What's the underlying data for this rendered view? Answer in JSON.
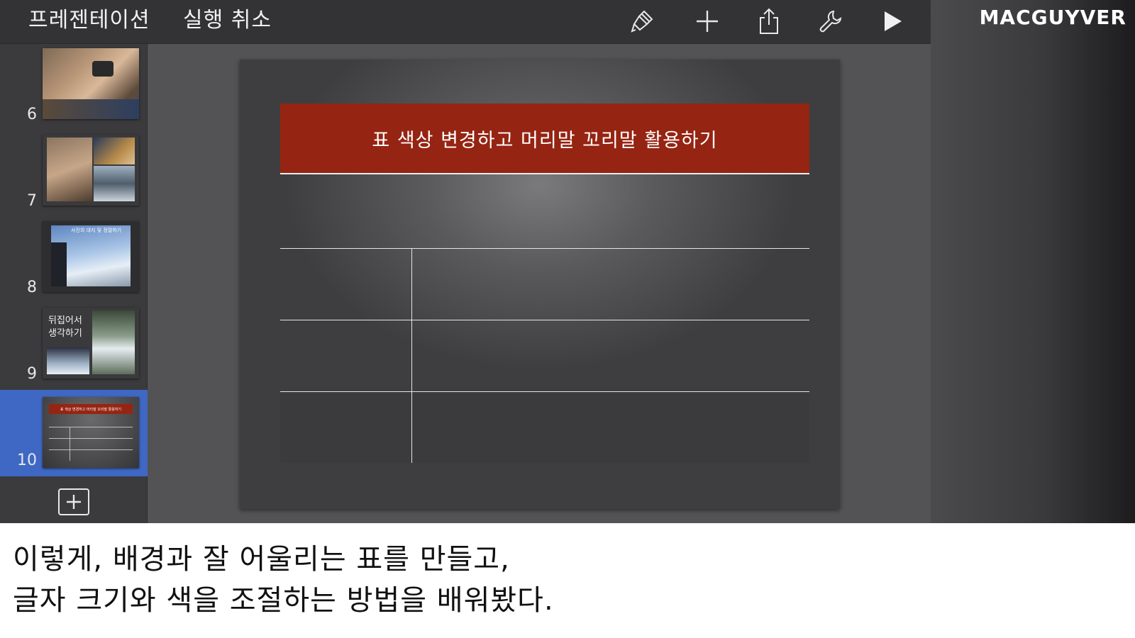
{
  "toolbar": {
    "presentation_label": "프레젠테이션",
    "undo_label": "실행 취소",
    "icons": [
      "format-brush-icon",
      "add-icon",
      "share-icon",
      "wrench-icon",
      "play-icon"
    ]
  },
  "brand": "MACGUYVER",
  "sidebar": {
    "slides": [
      {
        "number": "6"
      },
      {
        "number": "7"
      },
      {
        "number": "8",
        "thumb_text": "사진의 대지 및 정렬하기"
      },
      {
        "number": "9",
        "thumb_text_line1": "뒤집어서",
        "thumb_text_line2": "생각하기"
      },
      {
        "number": "10",
        "selected": true,
        "thumb_text": "표 색상 변경하고 머리말 꼬리말 활용하기"
      }
    ]
  },
  "slide": {
    "title": "표 색상 변경하고 머리말 꼬리말 활용하기",
    "title_color": "#962412",
    "table_rows": 3,
    "table_cols": 2
  },
  "caption": {
    "line1": "이렇게, 배경과 잘 어울리는 표를 만들고,",
    "line2": "글자 크기와 색을 조절하는 방법을 배워봤다."
  },
  "colors": {
    "selection": "#3f68c4",
    "toolbar": "#333335"
  }
}
